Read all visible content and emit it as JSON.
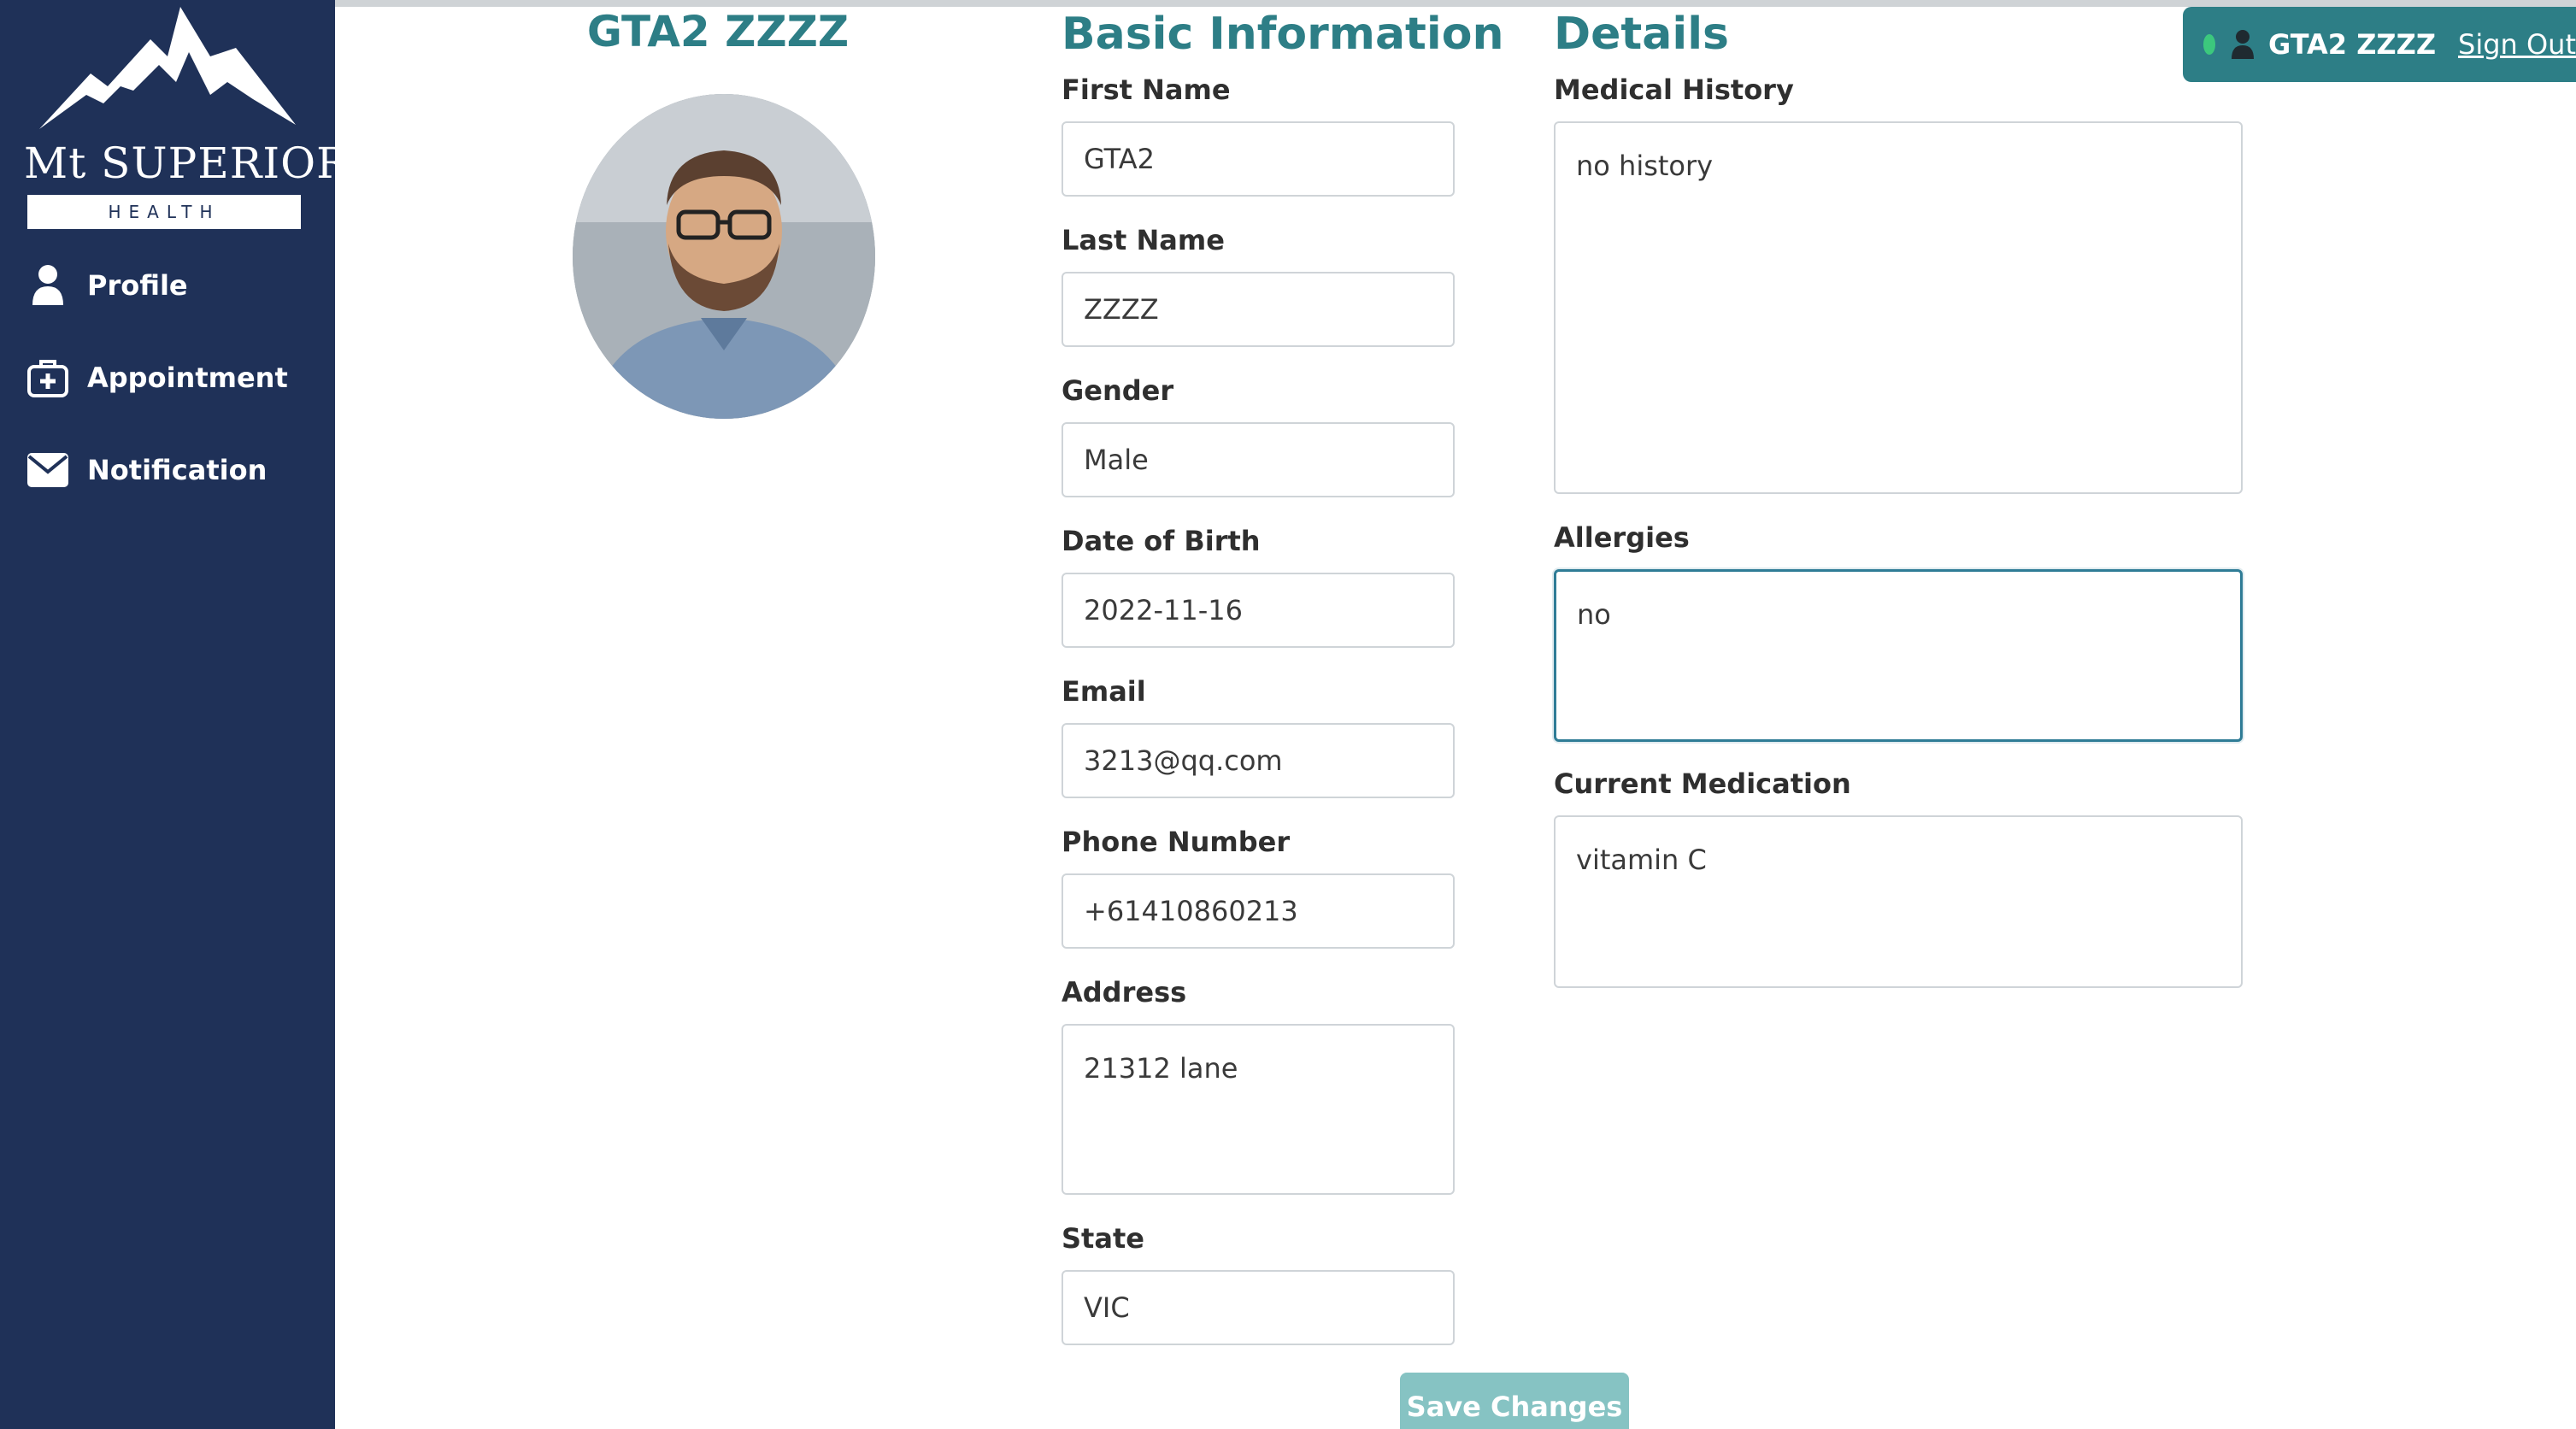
{
  "brand": {
    "name": "Mt SUPERIOR",
    "tagline": "HEALTH"
  },
  "sidebar": {
    "items": [
      {
        "label": "Profile",
        "icon": "person-icon"
      },
      {
        "label": "Appointment",
        "icon": "medical-bag-icon"
      },
      {
        "label": "Notification",
        "icon": "envelope-icon"
      }
    ]
  },
  "profile": {
    "display_name": "GTA2 ZZZZ",
    "avatar": "user-photo"
  },
  "basic_info": {
    "title": "Basic Information",
    "first_name": {
      "label": "First Name",
      "value": "GTA2"
    },
    "last_name": {
      "label": "Last Name",
      "value": "ZZZZ"
    },
    "gender": {
      "label": "Gender",
      "value": "Male"
    },
    "dob": {
      "label": "Date of Birth",
      "value": "2022-11-16"
    },
    "email": {
      "label": "Email",
      "value": "3213@qq.com"
    },
    "phone": {
      "label": "Phone Number",
      "value": "+61410860213"
    },
    "address": {
      "label": "Address",
      "value": "21312 lane"
    },
    "state": {
      "label": "State",
      "value": "VIC"
    }
  },
  "details": {
    "title": "Details",
    "medical_history": {
      "label": "Medical History",
      "value": "no history"
    },
    "allergies": {
      "label": "Allergies",
      "value": "no"
    },
    "current_medication": {
      "label": "Current Medication",
      "value": "vitamin C"
    }
  },
  "actions": {
    "save_label": "Save Changes"
  },
  "account": {
    "name": "GTA2 ZZZZ",
    "sign_out_label": "Sign Out",
    "status_color": "#3cc87d"
  },
  "colors": {
    "sidebar": "#1f3158",
    "accent": "#2d7e86",
    "button": "#86c3c3"
  }
}
